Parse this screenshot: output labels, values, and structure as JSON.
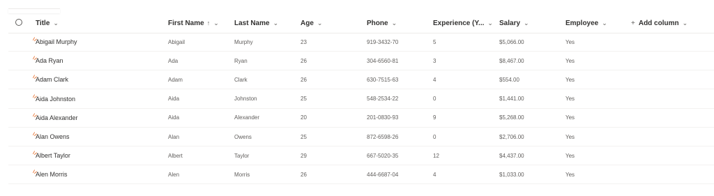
{
  "columns": {
    "title": "Title",
    "first_name": "First Name",
    "last_name": "Last Name",
    "age": "Age",
    "phone": "Phone",
    "experience": "Experience (Y...",
    "salary": "Salary",
    "employee": "Employee",
    "add_column": "Add column"
  },
  "icons": {
    "chevron": "chevron-down-icon",
    "sort": "sort-ascending-icon",
    "new_item": "new-item-icon",
    "add": "plus-icon"
  },
  "colors": {
    "new_item_accent": "#e8793a"
  },
  "rows": [
    {
      "title": "Abigail Murphy",
      "first_name": "Abigail",
      "last_name": "Murphy",
      "age": "23",
      "phone": "919-3432-70",
      "experience": "5",
      "salary": "$5,066.00",
      "employee": "Yes"
    },
    {
      "title": "Ada Ryan",
      "first_name": "Ada",
      "last_name": "Ryan",
      "age": "26",
      "phone": "304-6560-81",
      "experience": "3",
      "salary": "$8,467.00",
      "employee": "Yes"
    },
    {
      "title": "Adam Clark",
      "first_name": "Adam",
      "last_name": "Clark",
      "age": "26",
      "phone": "630-7515-63",
      "experience": "4",
      "salary": "$554.00",
      "employee": "Yes"
    },
    {
      "title": "Aida Johnston",
      "first_name": "Aida",
      "last_name": "Johnston",
      "age": "25",
      "phone": "548-2534-22",
      "experience": "0",
      "salary": "$1,441.00",
      "employee": "Yes"
    },
    {
      "title": "Aida Alexander",
      "first_name": "Aida",
      "last_name": "Alexander",
      "age": "20",
      "phone": "201-0830-93",
      "experience": "9",
      "salary": "$5,268.00",
      "employee": "Yes"
    },
    {
      "title": "Alan Owens",
      "first_name": "Alan",
      "last_name": "Owens",
      "age": "25",
      "phone": "872-6598-26",
      "experience": "0",
      "salary": "$2,706.00",
      "employee": "Yes"
    },
    {
      "title": "Albert Taylor",
      "first_name": "Albert",
      "last_name": "Taylor",
      "age": "29",
      "phone": "667-5020-35",
      "experience": "12",
      "salary": "$4,437.00",
      "employee": "Yes"
    },
    {
      "title": "Alen Morris",
      "first_name": "Alen",
      "last_name": "Morris",
      "age": "26",
      "phone": "444-6687-04",
      "experience": "4",
      "salary": "$1,033.00",
      "employee": "Yes"
    }
  ]
}
